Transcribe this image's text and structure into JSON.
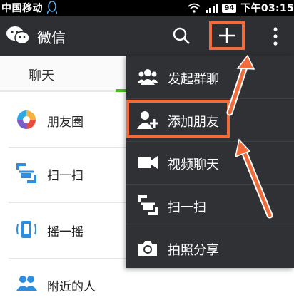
{
  "status_bar": {
    "carrier": "中国移动",
    "battery": "94",
    "time": "下午03:15"
  },
  "app_bar": {
    "title": "微信",
    "icons": [
      "wechat-logo-icon",
      "search-icon",
      "plus-icon",
      "more-icon"
    ]
  },
  "tabs": {
    "chat_label": "聊天"
  },
  "discover_list": [
    {
      "label": "朋友圈",
      "icon": "moments-icon"
    },
    {
      "label": "扫一扫",
      "icon": "scan-icon"
    },
    {
      "label": "摇一摇",
      "icon": "shake-icon"
    },
    {
      "label": "附近的人",
      "icon": "nearby-people-icon"
    }
  ],
  "popup_menu": [
    {
      "label": "发起群聊",
      "icon": "group-chat-icon"
    },
    {
      "label": "添加朋友",
      "icon": "add-friend-icon"
    },
    {
      "label": "视频聊天",
      "icon": "video-chat-icon"
    },
    {
      "label": "扫一扫",
      "icon": "scan-icon"
    },
    {
      "label": "拍照分享",
      "icon": "camera-icon"
    }
  ],
  "colors": {
    "app_bar_bg": "#2d2f33",
    "menu_bg": "#2f3134",
    "highlight_orange": "#f26b3a",
    "tab_green": "#46c11e"
  }
}
